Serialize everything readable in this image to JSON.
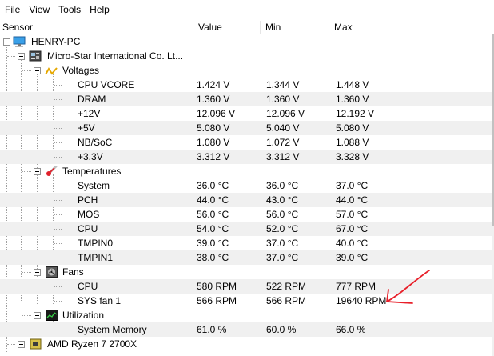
{
  "menu": [
    "File",
    "View",
    "Tools",
    "Help"
  ],
  "columns": {
    "sensor": "Sensor",
    "value": "Value",
    "min": "Min",
    "max": "Max"
  },
  "tree": {
    "root": "HENRY-PC",
    "board": "Micro-Star International Co. Lt...",
    "voltages": {
      "label": "Voltages",
      "rows": [
        {
          "name": "CPU VCORE",
          "value": "1.424 V",
          "min": "1.344 V",
          "max": "1.448 V"
        },
        {
          "name": "DRAM",
          "value": "1.360 V",
          "min": "1.360 V",
          "max": "1.360 V"
        },
        {
          "name": "+12V",
          "value": "12.096 V",
          "min": "12.096 V",
          "max": "12.192 V"
        },
        {
          "name": "+5V",
          "value": "5.080 V",
          "min": "5.040 V",
          "max": "5.080 V"
        },
        {
          "name": "NB/SoC",
          "value": "1.080 V",
          "min": "1.072 V",
          "max": "1.088 V"
        },
        {
          "name": "+3.3V",
          "value": "3.312 V",
          "min": "3.312 V",
          "max": "3.328 V"
        }
      ]
    },
    "temperatures": {
      "label": "Temperatures",
      "rows": [
        {
          "name": "System",
          "value": "36.0 °C",
          "min": "36.0 °C",
          "max": "37.0 °C"
        },
        {
          "name": "PCH",
          "value": "44.0 °C",
          "min": "43.0 °C",
          "max": "44.0 °C"
        },
        {
          "name": "MOS",
          "value": "56.0 °C",
          "min": "56.0 °C",
          "max": "57.0 °C"
        },
        {
          "name": "CPU",
          "value": "54.0 °C",
          "min": "52.0 °C",
          "max": "67.0 °C"
        },
        {
          "name": "TMPIN0",
          "value": "39.0 °C",
          "min": "37.0 °C",
          "max": "40.0 °C"
        },
        {
          "name": "TMPIN1",
          "value": "38.0 °C",
          "min": "37.0 °C",
          "max": "39.0 °C"
        }
      ]
    },
    "fans": {
      "label": "Fans",
      "rows": [
        {
          "name": "CPU",
          "value": "580 RPM",
          "min": "522 RPM",
          "max": "777 RPM"
        },
        {
          "name": "SYS fan 1",
          "value": "566 RPM",
          "min": "566 RPM",
          "max": "19640 RPM"
        }
      ]
    },
    "utilization": {
      "label": "Utilization",
      "rows": [
        {
          "name": "System Memory",
          "value": "61.0 %",
          "min": "60.0 %",
          "max": "66.0 %"
        }
      ]
    },
    "cpu": "AMD Ryzen 7 2700X"
  },
  "colors": {
    "annotation": "#e8202a",
    "alt_row": "#f0f0f0",
    "header_divider": "#e5e5e5"
  }
}
